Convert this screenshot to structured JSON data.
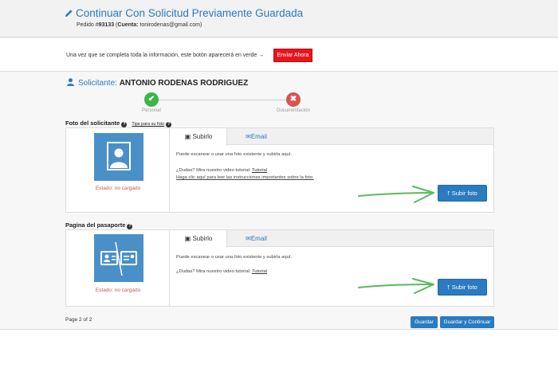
{
  "header": {
    "title": "Continuar Con Solicitud Previamente Guardada",
    "order_prefix": "Pedido #",
    "order_number": "93133",
    "account_label": "Cuenta:",
    "account_email": "tonirodenas@gmail.com"
  },
  "notice": {
    "text": "Una vez que se completa toda la información, este botón aparecerá en verde",
    "arrow": "→",
    "send_label": "Enviar Ahora"
  },
  "applicant": {
    "label": "Solicitante:",
    "name": "ANTONIO RODENAS RODRIGUEZ"
  },
  "steps": [
    {
      "label": "Personal",
      "state": "done",
      "symbol": "✔",
      "color": "#3ab54a"
    },
    {
      "label": "Documentación",
      "state": "missing",
      "symbol": "✖",
      "color": "#d9534f"
    }
  ],
  "sections": [
    {
      "title": "Foto del solicitante",
      "tips": "Tips para su foto",
      "tab_upload": "Subirlo",
      "tab_email": "Email",
      "line1": "Puede escanear o usar una foto existente y subirla aquí.",
      "line2_prefix": "¿Dudas? Mira nuestro video tutorial: ",
      "line2_link": "Tutorial",
      "line3": "Haga clic aquí para leer las instrucciones importantes sobre la foto.",
      "status": "Estado: no cargado",
      "button": "Subir foto",
      "icon": "portrait-icon"
    },
    {
      "title": "Pagina del pasaporte",
      "tab_upload": "Subirlo",
      "tab_email": "Email",
      "line1": "Puede escanear o usar una foto existente y subirla aquí.",
      "line2_prefix": "¿Dudas? Mira nuestro video tutorial: ",
      "line2_link": "Tutorial",
      "status": "Estado: no cargado",
      "button": "Subir foto",
      "icon": "passport-icon"
    }
  ],
  "footer": {
    "page": "Page 2 of 2",
    "save": "Guardar",
    "save_continue": "Guardar y Continuar"
  },
  "colors": {
    "brand_blue": "#2a7bc0",
    "danger_red": "#e8141e",
    "arrow_green": "#5cb85c"
  }
}
